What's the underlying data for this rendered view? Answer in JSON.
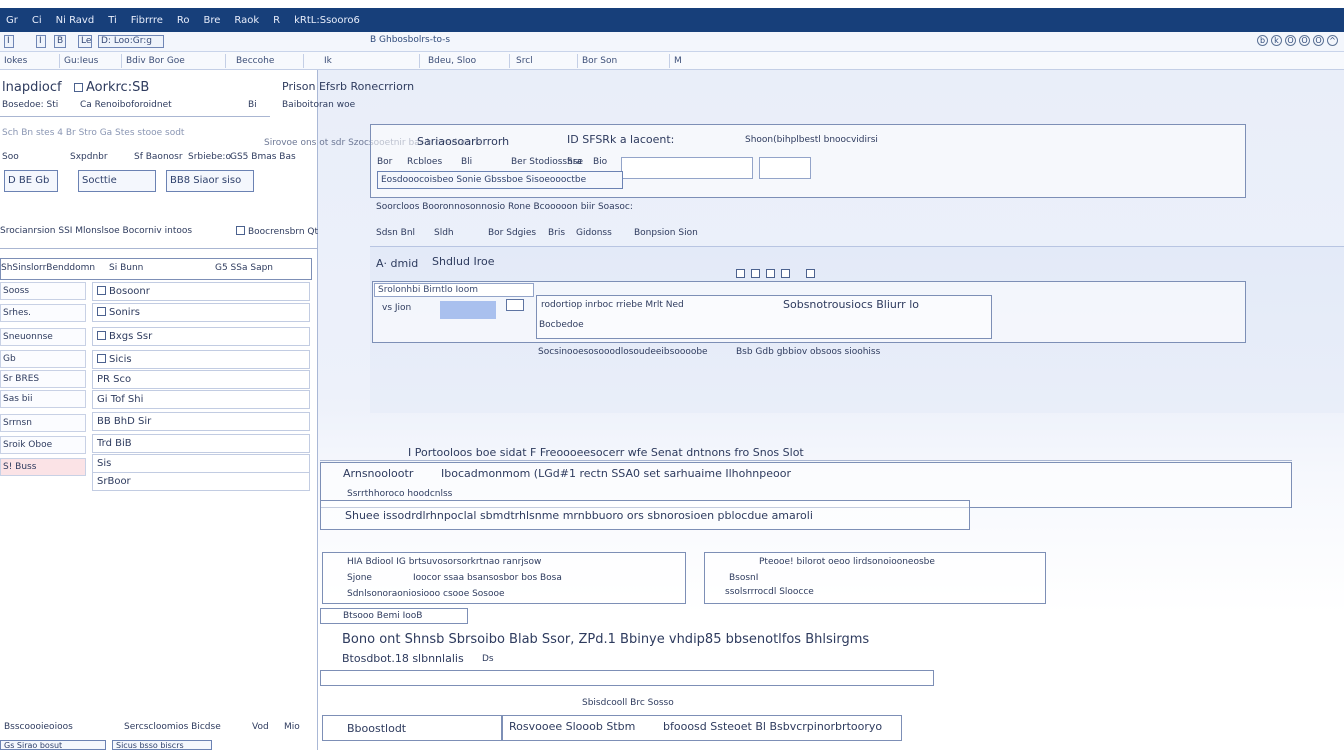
{
  "topbar": {
    "items": [
      "Gr",
      "Ci",
      "Ni Ravd",
      "Ti",
      "Fibrrre",
      "Ro",
      "Bre",
      "Raok",
      "R",
      "kRtL:Ssooro6"
    ]
  },
  "toolbar": {
    "left_buttons": [
      "I",
      "I",
      "B",
      "Le",
      "D: Loo:Gr:g"
    ],
    "center_label": "B Ghbosbolrs-to-s",
    "window_icons": [
      "b",
      "k",
      "O",
      "O",
      "O",
      "^"
    ]
  },
  "tabs": [
    "Iokes",
    "Gu:Ieus",
    "Bdiv Bor Goe",
    "Beccohe",
    "Ik",
    "Bdeu, Sloo",
    "Srcl",
    "Bor Son",
    "M"
  ],
  "left": {
    "header1": "lnapdiocf",
    "header1b": "Aorkrc:SB",
    "sub1": "Bosedoe: Sti",
    "sub1b": "Ca Renoiboforoidnet",
    "sub1c": "Bi",
    "faint_row": "Sch Bn stes 4 Br Stro Ga Stes stooe sodt",
    "row2": [
      "Soo",
      "Sxpdnbr",
      "Sf Baonosr",
      "Srbiebe:o",
      "GS5 Bmas Bas"
    ],
    "buttons": [
      "D BE Gb",
      "Socttie",
      "BB8 Siaor siso"
    ],
    "section_title": "Srocianrsion SSI Mlonslsoe Bocorniv intoos",
    "section_title2": "Boocrensbrn Qtoz biq I sss",
    "grid_headers": [
      "ShSinslorrBenddomn",
      "Si Bunn",
      "G5 SSa Sapn"
    ],
    "left_rows": [
      "Sooss",
      "Srhes.",
      "Sneuonnse",
      "Gb",
      "Sr BRES",
      "Sas bii",
      "Srrnsn",
      "Sroik Oboe",
      "S! Buss"
    ],
    "right_rows": [
      "Bosoonr",
      "Sonirs",
      "Bxgs Ssr",
      "Sicis",
      "PR Sco",
      "Gi Tof Shi",
      "BB BhD Sir",
      "Trd BiB",
      "Sis",
      "SrBoor"
    ],
    "bottom": [
      "Bsscoooieoioos",
      "Sercscloomios Bicdse",
      "Vod",
      "Mio"
    ],
    "bottom2": [
      "Gs Sirao bosut",
      "Sicus bsso biscrs"
    ]
  },
  "main": {
    "breadcrumb1": "Prison Efsrb",
    "breadcrumb1b": "Ronecrriorn",
    "breadcrumb2": "Baiboitoran woe",
    "top_faint": "Sirovoe ons ot sdr Szocsooetnir bar b ovedronre",
    "panel1_title": "Sariaosoarbrrorh",
    "panel1_title2": "ID SFSRk a lacoent:",
    "panel1_right": "Shoon(bihplbestl bnoocvidirsi",
    "panel1_row": [
      "Bor",
      "Rcbloes",
      "Bli",
      "Ber Stodiosshse",
      "Sra",
      "Bio"
    ],
    "panel1_buttons": [
      "Eosdooocoisbeo",
      "Sonie Gbssboe",
      "Sisoeoooctbe"
    ],
    "panel1_info": "Soorcloos Booronnosonnosio Rone Bcooooon biir Soasoc:",
    "panel1_tabs": [
      "Sdsn Bnl",
      "Sldh",
      "Bor Sdgies",
      "Bris",
      "Gidonss",
      "Bonpsion Sion"
    ],
    "panel2_title": "A· dmid",
    "panel2_title2": "Shdlud Iroe",
    "panel2_field": "Srolonhbi Birntlo Ioom",
    "panel2_label": "vs Jion",
    "panel2_text": "rodortiop inrboc rriebe Mrlt Ned",
    "panel2_link": "Sobsnotrousiocs Bliurr lo",
    "panel2_note": "Bocbedoe",
    "panel2_footer": "Socsinooesosooodlosoudeeibsoooobe",
    "panel2_footer2": "Bsb Gdb gbbiov obsoos sioohiss",
    "info_line": "I Portooloos boe sidat F Freoooeesocerr wfe Senat dntnons fro Snos Slot",
    "sec1_title": "Arnsnoolootr",
    "sec1_text": "Ibocadmonmom (LGd#1 rectn SSA0 set sarhuaime Ilhohnpeoor",
    "sec1_sub": "Ssrrthhoroco hoodcnlss",
    "sec2_text": "Shuee issodrdlrhnpoclal sbmdtrhlsnme mrnbbuoro ors sbnorosioen pblocdue amaroli",
    "card1_lines": [
      "HIA Bdiool IG brtsuvosorsorkrtnao ranrjsow",
      "Sjone",
      "Ioocor ssaa bsansosbor bos Bosa",
      "Sdnlsonoraoniosiooo csooe Sosooe"
    ],
    "card2_lines": [
      "Pteooe! bilorot oeoo lirdsonoiooneosbe",
      "BsosnI",
      "ssolsrrrocdl Sloocce"
    ],
    "sec3": "Btsooo Bemi IooB",
    "sec4_title": "Bono ont Shnsb Sbrsoibo Blab Ssor, ZPd.1 Bbinye vhdip85 bbsenotlfos Bhlsirgms",
    "sec4_sub": "Btosdbot.18 slbnnlalis",
    "sec4_sub2": "Ds",
    "sec5_left": "Bboostlodt",
    "sec5_center": "Sbisdcooll Brc Sosso",
    "sec5_mid": "Rosvooee Slooob Stbm",
    "sec5_right": "bfooosd Ssteoet Bl Bsbvcrpinorbrtooryo"
  },
  "colors": {
    "topbar": "#173f7a",
    "accent": "#a9c0ee",
    "selected_row": "#fbe3e6"
  }
}
